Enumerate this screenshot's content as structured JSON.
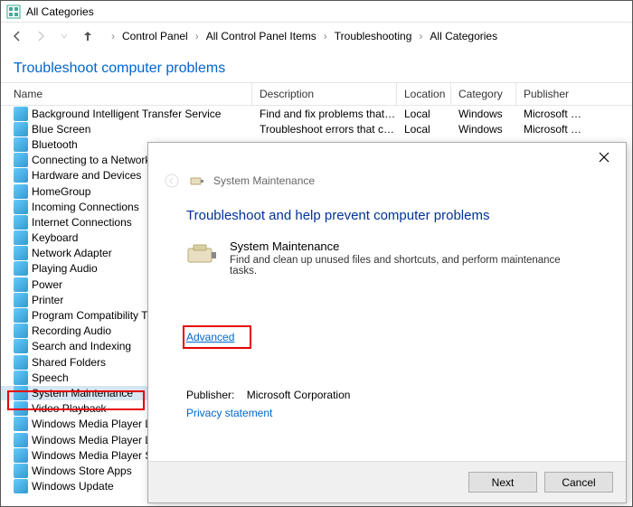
{
  "window": {
    "title": "All Categories"
  },
  "breadcrumb": [
    "Control Panel",
    "All Control Panel Items",
    "Troubleshooting",
    "All Categories"
  ],
  "heading": "Troubleshoot computer problems",
  "columns": {
    "name": "Name",
    "description": "Description",
    "location": "Location",
    "category": "Category",
    "publisher": "Publisher"
  },
  "rows": [
    {
      "name": "Background Intelligent Transfer Service",
      "desc": "Find and fix problems that may p…",
      "loc": "Local",
      "cat": "Windows",
      "pub": "Microsoft …"
    },
    {
      "name": "Blue Screen",
      "desc": "Troubleshoot errors that cause Wi…",
      "loc": "Local",
      "cat": "Windows",
      "pub": "Microsoft …"
    },
    {
      "name": "Bluetooth"
    },
    {
      "name": "Connecting to a Network"
    },
    {
      "name": "Hardware and Devices"
    },
    {
      "name": "HomeGroup"
    },
    {
      "name": "Incoming Connections"
    },
    {
      "name": "Internet Connections"
    },
    {
      "name": "Keyboard"
    },
    {
      "name": "Network Adapter"
    },
    {
      "name": "Playing Audio"
    },
    {
      "name": "Power"
    },
    {
      "name": "Printer"
    },
    {
      "name": "Program Compatibility Troubleshooter"
    },
    {
      "name": "Recording Audio"
    },
    {
      "name": "Search and Indexing"
    },
    {
      "name": "Shared Folders"
    },
    {
      "name": "Speech"
    },
    {
      "name": "System Maintenance",
      "selected": true
    },
    {
      "name": "Video Playback"
    },
    {
      "name": "Windows Media Player Library"
    },
    {
      "name": "Windows Media Player Library"
    },
    {
      "name": "Windows Media Player Settings"
    },
    {
      "name": "Windows Store Apps"
    },
    {
      "name": "Windows Update"
    }
  ],
  "dialog": {
    "breadcrumb": "System Maintenance",
    "heading": "Troubleshoot and help prevent computer problems",
    "item_title": "System Maintenance",
    "item_desc": "Find and clean up unused files and shortcuts, and perform maintenance tasks.",
    "advanced": "Advanced",
    "publisher_label": "Publisher:",
    "publisher_value": "Microsoft Corporation",
    "privacy": "Privacy statement",
    "next": "Next",
    "cancel": "Cancel"
  }
}
